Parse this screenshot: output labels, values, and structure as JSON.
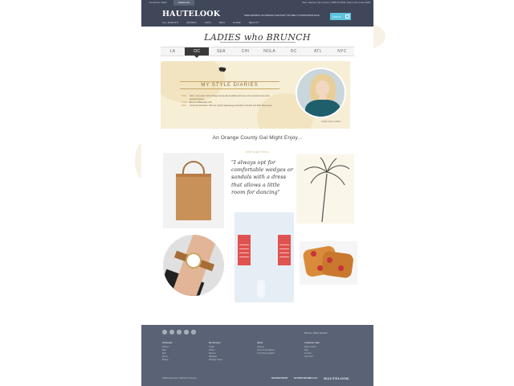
{
  "topbar": {
    "sites": [
      "Nordstrom Rack",
      "HauteLook"
    ],
    "utility": "Hello, Valentina  |  My Account  |  1-888-979-4636  |  Help  |  Invite & Earn $100"
  },
  "header": {
    "logo": "HAUTELOOK",
    "promo": "FREE SHIPPING ON ORDERS OVER $100* OR FREE TO NORDSTROM RACK",
    "login_label": "LOG IN",
    "nav": [
      "ALL EVENTS",
      "WOMEN",
      "KIDS",
      "MEN",
      "HOME",
      "BEAUTY"
    ]
  },
  "page": {
    "title": "LADIES who BRUNCH",
    "tabs": [
      {
        "label": "LA",
        "active": false
      },
      {
        "label": "OC",
        "active": true
      },
      {
        "label": "SEA",
        "active": false
      },
      {
        "label": "CHI",
        "active": false
      },
      {
        "label": "NOLA",
        "active": false
      },
      {
        "label": "DC",
        "active": false
      },
      {
        "label": "ATL",
        "active": false
      },
      {
        "label": "NYC",
        "active": false
      }
    ]
  },
  "hero": {
    "title": "MY STYLE DIARIES",
    "items": [
      {
        "day": "MON",
        "text": "Hello, I am Lauren from Orange County. My breakfast with some of my favorite home-slice weekend pieces"
      },
      {
        "day": "TUES",
        "text": "Brunch at Bluewater Grill"
      },
      {
        "day": "WED",
        "text": "Under the Mermaid + VIP tour | Quick sightseeing at Southern Comfort and Main Street area"
      }
    ],
    "credit": "MORE FROM LAUREN",
    "accent": "#c59a46"
  },
  "gallery": {
    "title": "An Orange County Gal Might Enjoy...",
    "subtitle": "SHOP EVERYTHING",
    "quote": "\"I always opt for comfortable wedges or sandals with a dress that allows a little room for dancing\""
  },
  "footer": {
    "socials": [
      "f",
      "t",
      "p",
      "i",
      "g"
    ],
    "apps": "iPhone  |  iPad  |  Android",
    "columns": [
      {
        "head": "All Events",
        "links": [
          "Women",
          "Men",
          "Kids",
          "Home",
          "Beauty"
        ]
      },
      {
        "head": "My Account",
        "links": [
          "Profile",
          "Orders",
          "Returns",
          "Shipping",
          "Manage Invites"
        ]
      },
      {
        "head": "About",
        "links": [
          "Careers",
          "Terms & Conditions",
          "Your Privacy Rights"
        ]
      },
      {
        "head": "Customer Care",
        "links": [
          "Return Policy",
          "FAQ",
          "Contact",
          "Live Chat"
        ]
      }
    ],
    "copyright": "©2016 HauteLook, A Nordstrom Company",
    "brands": [
      "NORDSTROM",
      "NORDSTROMRACK",
      "HAUTELOOK"
    ]
  }
}
